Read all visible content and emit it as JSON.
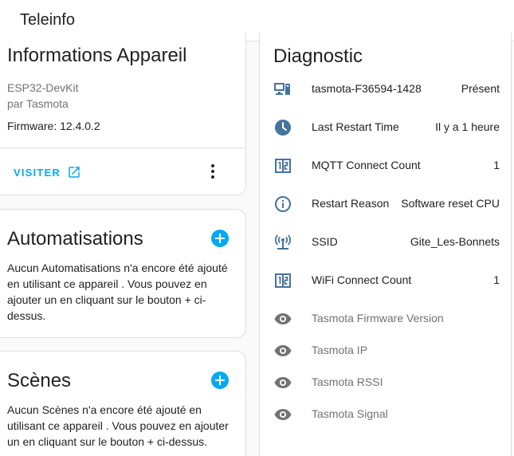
{
  "app": {
    "title": "Teleinfo"
  },
  "device_info": {
    "title": "Informations Appareil",
    "model": "ESP32-DevKit",
    "manufacturer": "par Tasmota",
    "firmware": "Firmware: 12.4.0.2",
    "visit_label": "VISITER"
  },
  "automations": {
    "title": "Automatisations",
    "text": "Aucun Automatisations n'a encore été ajouté en utilisant ce appareil . Vous pouvez en ajouter un en cliquant sur le bouton + ci-dessus."
  },
  "scenes": {
    "title": "Scènes",
    "text": "Aucun Scènes n'a encore été ajouté en utilisant ce appareil . Vous pouvez en ajouter un en cliquant sur le bouton + ci-dessus."
  },
  "diagnostic": {
    "title": "Diagnostic",
    "rows": [
      {
        "icon": "monitor-device-icon",
        "name": "tasmota-F36594-1428",
        "value": "Présent"
      },
      {
        "icon": "clock-icon",
        "name": "Last Restart Time",
        "value": "Il y a 1 heure"
      },
      {
        "icon": "counter-icon",
        "name": "MQTT Connect Count",
        "value": "1"
      },
      {
        "icon": "info-icon",
        "name": "Restart Reason",
        "value": "Software reset CPU"
      },
      {
        "icon": "wifi-antenna-icon",
        "name": "SSID",
        "value": "Gite_Les-Bonnets"
      },
      {
        "icon": "counter-icon",
        "name": "WiFi Connect Count",
        "value": "1"
      },
      {
        "icon": "eye-icon",
        "name": "Tasmota Firmware Version",
        "value": ""
      },
      {
        "icon": "eye-icon",
        "name": "Tasmota IP",
        "value": ""
      },
      {
        "icon": "eye-icon",
        "name": "Tasmota RSSI",
        "value": ""
      },
      {
        "icon": "eye-icon",
        "name": "Tasmota Signal",
        "value": ""
      }
    ]
  },
  "colors": {
    "accent": "#03a9f4",
    "icon": "#44739e",
    "muted_icon": "#727272"
  }
}
